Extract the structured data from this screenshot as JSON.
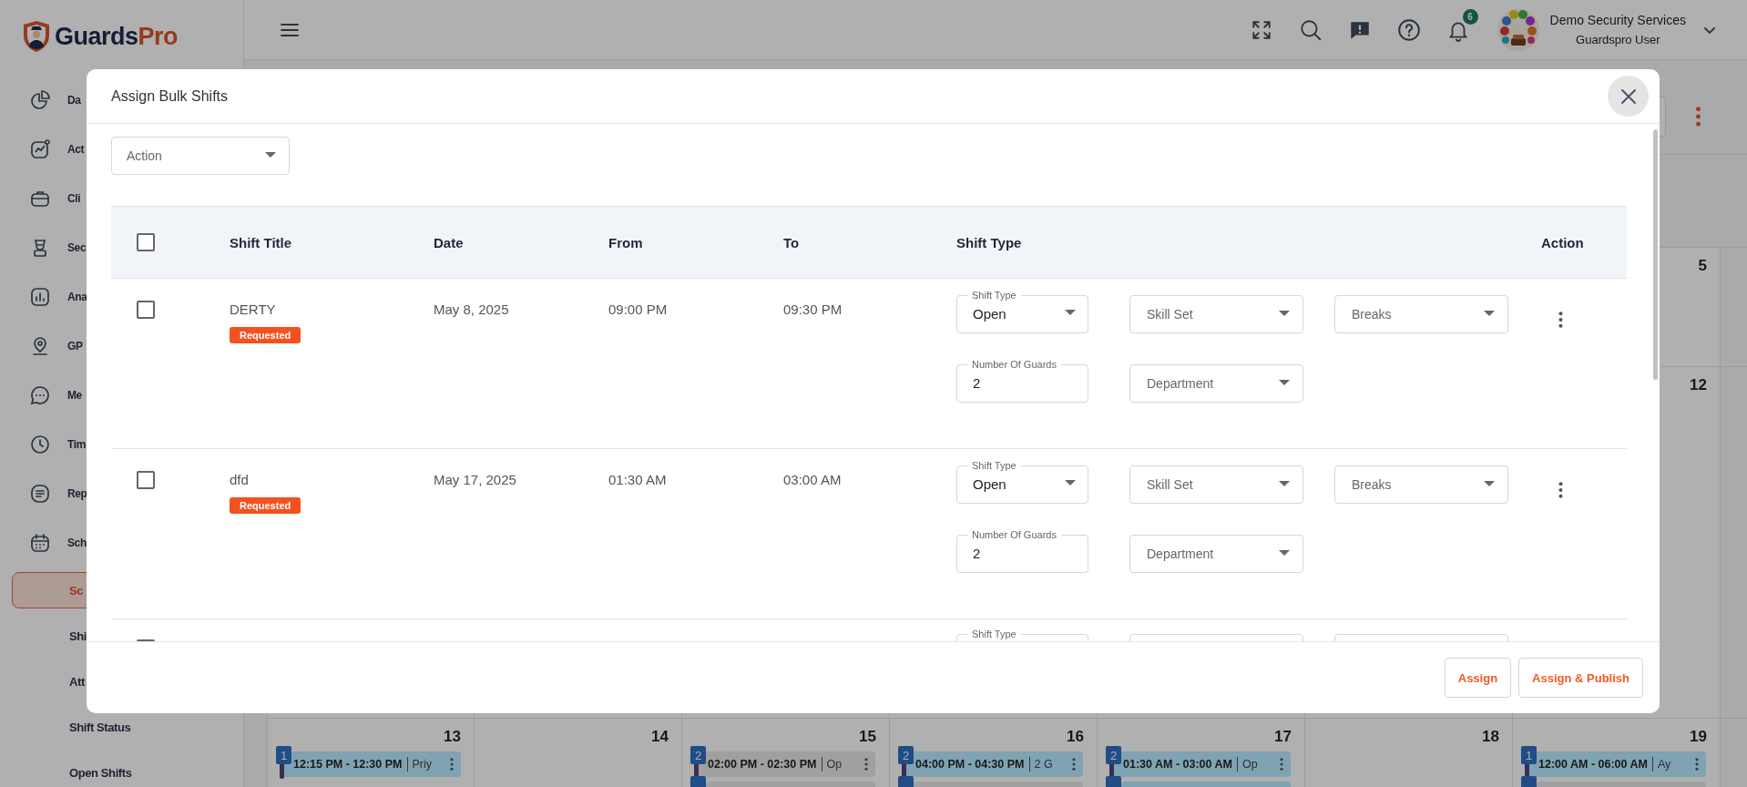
{
  "logo": {
    "brand": [
      "Guards",
      "Pro"
    ]
  },
  "sidebar": {
    "items": [
      {
        "label": "Da",
        "selected": false
      },
      {
        "label": "Act",
        "selected": false
      },
      {
        "label": "Cli",
        "selected": false
      },
      {
        "label": "Sec",
        "selected": false
      },
      {
        "label": "Ana",
        "selected": false
      },
      {
        "label": "GP",
        "selected": false
      },
      {
        "label": "Me",
        "selected": false
      },
      {
        "label": "Tim",
        "selected": false
      },
      {
        "label": "Rep",
        "selected": false
      },
      {
        "label": "Sch",
        "selected": false,
        "children": [
          {
            "label": "Sc",
            "selected": true
          },
          {
            "label": "Shi",
            "selected": false
          },
          {
            "label": "Att",
            "selected": false
          },
          {
            "label": "Shift Status",
            "selected": false
          },
          {
            "label": "Open Shifts",
            "selected": false
          }
        ]
      }
    ]
  },
  "header": {
    "notification_count": "6",
    "user": {
      "company": "Demo Security Services",
      "name": "Guardspro User"
    }
  },
  "calendar": {
    "weeks": [
      {
        "days": [
          {
            "day": "5"
          }
        ]
      },
      {
        "days": [
          {
            "day": "12"
          }
        ]
      },
      {
        "days": [
          {
            "day": "13",
            "shifts": [
              {
                "badge": "1",
                "time": "12:15 PM - 12:30 PM",
                "detail": "Priy",
                "color": "#7fa3b2"
              }
            ]
          },
          {
            "day": "14"
          },
          {
            "day": "15",
            "shifts": [
              {
                "badge": "2",
                "time": "02:00 PM - 02:30 PM",
                "detail": "Op",
                "color": "#a0a0a0"
              },
              {
                "color": "#a0a0a0"
              }
            ]
          },
          {
            "day": "16",
            "shifts": [
              {
                "badge": "2",
                "time": "04:00 PM - 04:30 PM",
                "detail": "2 G",
                "color": "#7fa3b2"
              },
              {
                "color": "#a0a0a0"
              }
            ]
          },
          {
            "day": "17",
            "shifts": [
              {
                "badge": "2",
                "time": "01:30 AM - 03:00 AM",
                "detail": "Op",
                "color": "#7fa3b2"
              },
              {
                "color": "#7fa3b2"
              }
            ]
          },
          {
            "day": "18"
          },
          {
            "day": "19",
            "shifts": [
              {
                "badge": "1",
                "time": "12:00 AM - 06:00 AM",
                "detail": "Ay",
                "color": "#7fa3b2"
              },
              {
                "color": "#a0a0a0"
              }
            ]
          }
        ]
      }
    ]
  },
  "modal": {
    "title": "Assign Bulk Shifts",
    "action_select": {
      "placeholder": "Action"
    },
    "table": {
      "select_all": {
        "checked": false
      },
      "columns": [
        "Shift Title",
        "Date",
        "From",
        "To",
        "Shift Type",
        "Action"
      ],
      "rows": [
        {
          "checked": false,
          "title": "DERTY",
          "status": "Requested",
          "date": "May 8, 2025",
          "from": "09:00 PM",
          "to": "09:30 PM",
          "fields": [
            {
              "kind": "select",
              "label": "Shift Type",
              "value": "Open"
            },
            {
              "kind": "select",
              "placeholder": "Skill Set"
            },
            {
              "kind": "select",
              "placeholder": "Breaks"
            },
            {
              "kind": "input",
              "label": "Number Of Guards",
              "value": "2"
            },
            {
              "kind": "select",
              "placeholder": "Department"
            }
          ]
        },
        {
          "checked": false,
          "title": "dfd",
          "status": "Requested",
          "date": "May 17, 2025",
          "from": "01:30 AM",
          "to": "03:00 AM",
          "fields": [
            {
              "kind": "select",
              "label": "Shift Type",
              "value": "Open"
            },
            {
              "kind": "select",
              "placeholder": "Skill Set"
            },
            {
              "kind": "select",
              "placeholder": "Breaks"
            },
            {
              "kind": "input",
              "label": "Number Of Guards",
              "value": "2"
            },
            {
              "kind": "select",
              "placeholder": "Department"
            }
          ]
        }
      ],
      "partial_row": {
        "checked": false,
        "fields": [
          {
            "kind": "select",
            "label": "Shift Type"
          },
          {
            "kind": "select"
          },
          {
            "kind": "select"
          }
        ]
      }
    },
    "buttons": [
      "Assign",
      "Assign & Publish"
    ]
  }
}
